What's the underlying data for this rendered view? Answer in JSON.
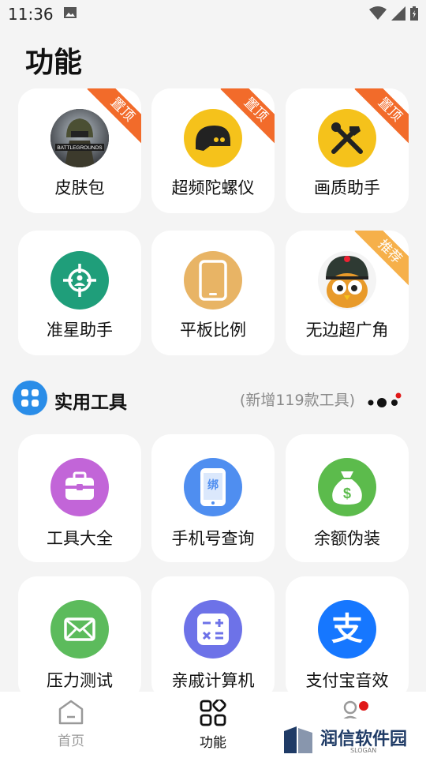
{
  "status_bar": {
    "time": "11:36"
  },
  "page_title": "功能",
  "featured": [
    {
      "label": "皮肤包",
      "badge": "置顶",
      "icon": "pubg-battlegrounds-icon"
    },
    {
      "label": "超频陀螺仪",
      "badge": "置顶",
      "icon": "helmet-icon"
    },
    {
      "label": "画质助手",
      "badge": "置顶",
      "icon": "tools-icon"
    },
    {
      "label": "准星助手",
      "badge": "",
      "icon": "crosshair-icon"
    },
    {
      "label": "平板比例",
      "badge": "",
      "icon": "tablet-icon"
    },
    {
      "label": "无边超广角",
      "badge": "推荐",
      "icon": "owl-helmet-icon"
    }
  ],
  "section": {
    "title": "实用工具",
    "subtitle": "(新增119款工具)"
  },
  "tools": [
    {
      "label": "工具大全",
      "icon": "toolbox-icon",
      "color": "#c265d8"
    },
    {
      "label": "手机号查询",
      "icon": "phone-bind-icon",
      "color": "#4f8ef0",
      "glyph": "绑"
    },
    {
      "label": "余额伪装",
      "icon": "money-bag-icon",
      "color": "#5cbb4c"
    },
    {
      "label": "压力测试",
      "icon": "mail-icon",
      "color": "#5cbb5c"
    },
    {
      "label": "亲戚计算机",
      "icon": "calculator-icon",
      "color": "#6d72e8"
    },
    {
      "label": "支付宝音效",
      "icon": "alipay-icon",
      "color": "#1677ff",
      "glyph": "支"
    }
  ],
  "tabbar": [
    {
      "label": "首页",
      "icon": "home-icon"
    },
    {
      "label": "功能",
      "icon": "grid-icon"
    },
    {
      "label": "",
      "icon": "profile-icon"
    }
  ],
  "watermark": {
    "text": "润信软件园",
    "sub": "SLOGAN"
  }
}
